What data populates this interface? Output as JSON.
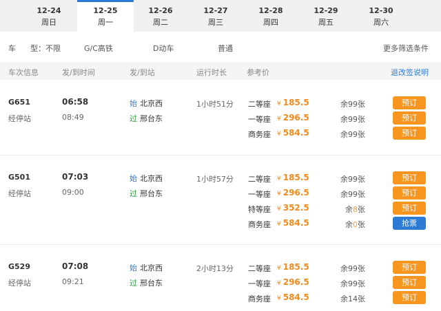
{
  "dates": [
    {
      "date": "12-24",
      "day": "周日"
    },
    {
      "date": "12-25",
      "day": "周一",
      "selected": true
    },
    {
      "date": "12-26",
      "day": "周二"
    },
    {
      "date": "12-27",
      "day": "周三"
    },
    {
      "date": "12-28",
      "day": "周四"
    },
    {
      "date": "12-29",
      "day": "周五"
    },
    {
      "date": "12-30",
      "day": "周六"
    }
  ],
  "filter": {
    "label_a": "车",
    "label_b": "型：不限",
    "opt1": "G/C高铁",
    "opt2": "D动车",
    "opt3": "普通",
    "more": "更多筛选条件"
  },
  "header": {
    "c1": "车次信息",
    "c2": "发/到时间",
    "c3": "发/到站",
    "c4": "运行时长",
    "c5": "参考价",
    "link": "退改签说明"
  },
  "stops_label": "经停站",
  "start_tag": "始",
  "pass_tag": "过",
  "currency": "¥",
  "trains": [
    {
      "no": "G651",
      "dep": "06:58",
      "arr": "08:49",
      "from": "北京西",
      "to": "邢台东",
      "duration": "1小时51分",
      "seats": [
        {
          "name": "二等座",
          "price": "185.5",
          "pre": "余",
          "num": "99",
          "suf": "张",
          "btn": "预订"
        },
        {
          "name": "一等座",
          "price": "296.5",
          "pre": "余",
          "num": "99",
          "suf": "张",
          "btn": "预订"
        },
        {
          "name": "商务座",
          "price": "584.5",
          "pre": "余",
          "num": "99",
          "suf": "张",
          "btn": "预订"
        }
      ]
    },
    {
      "no": "G501",
      "dep": "07:03",
      "arr": "09:00",
      "from": "北京西",
      "to": "邢台东",
      "duration": "1小时57分",
      "seats": [
        {
          "name": "二等座",
          "price": "185.5",
          "pre": "余",
          "num": "99",
          "suf": "张",
          "btn": "预订"
        },
        {
          "name": "一等座",
          "price": "296.5",
          "pre": "余",
          "num": "99",
          "suf": "张",
          "btn": "预订"
        },
        {
          "name": "特等座",
          "price": "352.5",
          "pre": "余",
          "num": "8",
          "suf": "张",
          "btn": "预订",
          "hl": true
        },
        {
          "name": "商务座",
          "price": "584.5",
          "pre": "余",
          "num": "0",
          "suf": "张",
          "btn": "抢票",
          "hl": true,
          "blue": true
        }
      ]
    },
    {
      "no": "G529",
      "dep": "07:08",
      "arr": "09:21",
      "from": "北京西",
      "to": "邢台东",
      "duration": "2小时13分",
      "seats": [
        {
          "name": "二等座",
          "price": "185.5",
          "pre": "余",
          "num": "99",
          "suf": "张",
          "btn": "预订"
        },
        {
          "name": "一等座",
          "price": "296.5",
          "pre": "余",
          "num": "99",
          "suf": "张",
          "btn": "预订"
        },
        {
          "name": "商务座",
          "price": "584.5",
          "pre": "余",
          "num": "14",
          "suf": "张",
          "btn": "预订"
        }
      ]
    }
  ]
}
